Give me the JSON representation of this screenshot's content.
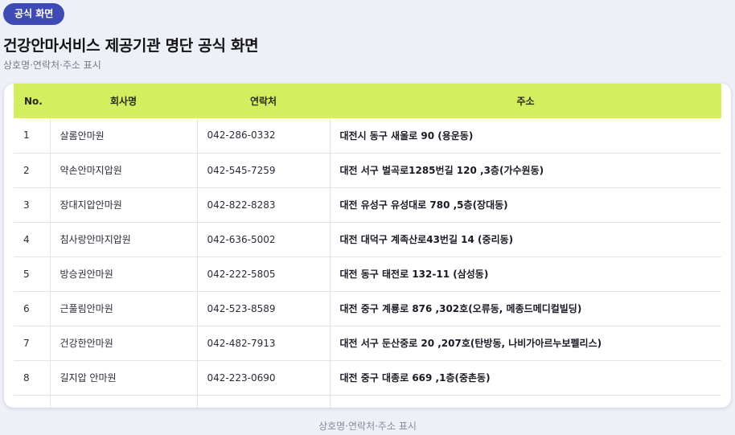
{
  "badge": "공식 화면",
  "title": "건강안마서비스 제공기관 명단 공식 화면",
  "subtitle": "상호명·연락처·주소 표시",
  "table": {
    "headers": [
      "No.",
      "회사명",
      "연락처",
      "주소"
    ],
    "rows": [
      {
        "no": "1",
        "name": "살롬안마원",
        "phone": "042-286-0332",
        "address": "대전시 동구 새울로 90 (용운동)"
      },
      {
        "no": "2",
        "name": "약손안마지압원",
        "phone": "042-545-7259",
        "address": "대전 서구 벌곡로1285번길 120 ,3층(가수원동)"
      },
      {
        "no": "3",
        "name": "장대지압안마원",
        "phone": "042-822-8283",
        "address": "대전 유성구 유성대로 780 ,5층(장대동)"
      },
      {
        "no": "4",
        "name": "침사랑안마지압원",
        "phone": "042-636-5002",
        "address": "대전 대덕구 계족산로43번길 14 (중리동)"
      },
      {
        "no": "5",
        "name": "방승권안마원",
        "phone": "042-222-5805",
        "address": "대전 동구 태전로 132-11 (삼성동)"
      },
      {
        "no": "6",
        "name": "근풀림안마원",
        "phone": "042-523-8589",
        "address": "대전 중구 계룡로 876 ,302호(오류동, 메종드메디컬빌딩)"
      },
      {
        "no": "7",
        "name": "건강한안마원",
        "phone": "042-482-7913",
        "address": "대전 서구 둔산중로 20 ,207호(탄방동, 나비가아르누보펠리스)"
      },
      {
        "no": "8",
        "name": "길지압 안마원",
        "phone": "042-223-0690",
        "address": "대전 중구 대종로 669 ,1층(중촌동)"
      }
    ]
  },
  "footer": "상호명·연락처·주소 표시",
  "colors": {
    "badge_bg": "#3e4bb5",
    "header_bg": "#d3ee5f",
    "page_bg": "#eef0f8"
  }
}
